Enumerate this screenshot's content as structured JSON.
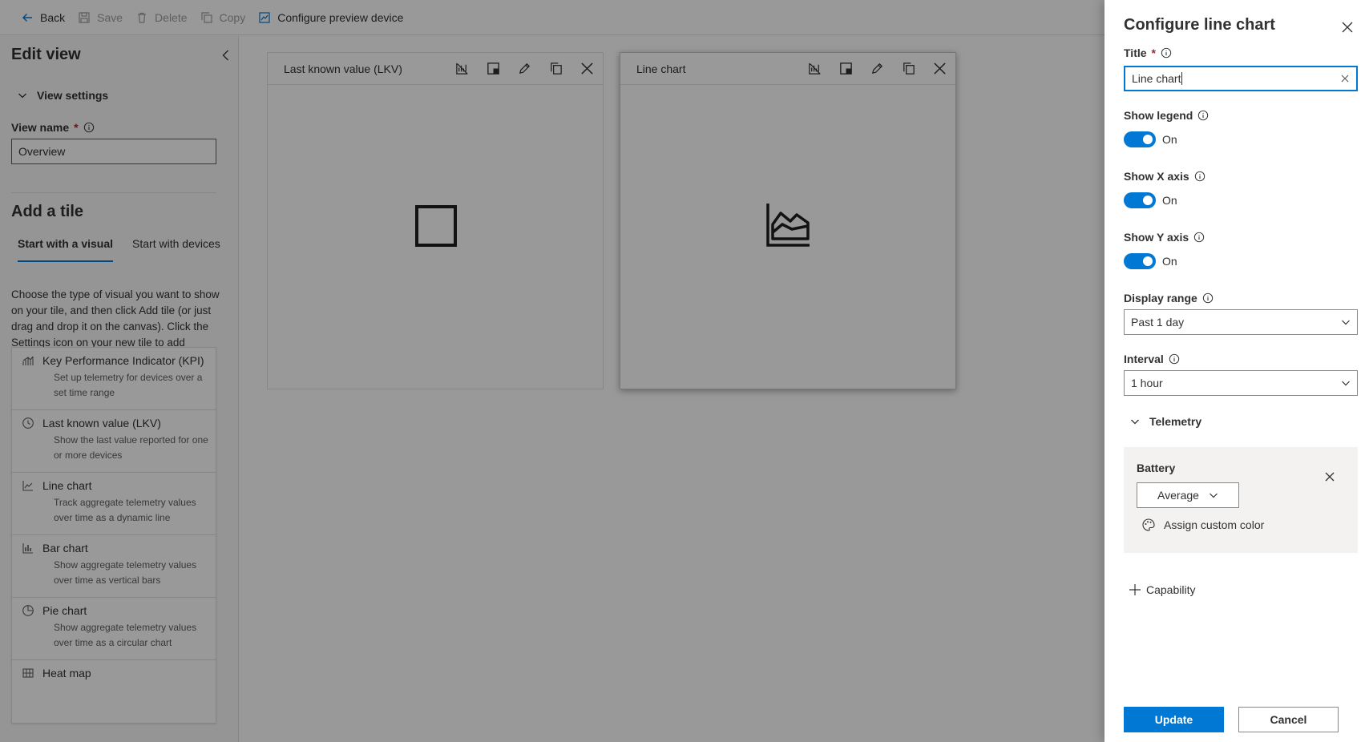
{
  "toolbar": {
    "back_label": "Back",
    "save_label": "Save",
    "delete_label": "Delete",
    "copy_label": "Copy",
    "configure_label": "Configure preview device"
  },
  "left_panel": {
    "title": "Edit view",
    "view_settings_label": "View settings",
    "view_name_label": "View name",
    "view_name_required": "*",
    "view_name_value": "Overview",
    "add_tile_title": "Add a tile",
    "tabs": [
      {
        "label": "Start with a visual",
        "active": true
      },
      {
        "label": "Start with devices",
        "active": false
      }
    ],
    "description": "Choose the type of visual you want to show on your tile, and then click Add tile (or just drag and drop it on the canvas). Click the Settings icon on your new tile to add content or device data.",
    "tiles": [
      {
        "icon": "kpi-icon",
        "title": "Key Performance Indicator (KPI)",
        "subtitle": "Set up telemetry for devices over a set time range"
      },
      {
        "icon": "clock-icon",
        "title": "Last known value (LKV)",
        "subtitle": "Show the last value reported for one or more devices"
      },
      {
        "icon": "line-chart-icon",
        "title": "Line chart",
        "subtitle": "Track aggregate telemetry values over time as a dynamic line"
      },
      {
        "icon": "bar-chart-icon",
        "title": "Bar chart",
        "subtitle": "Show aggregate telemetry values over time as vertical bars"
      },
      {
        "icon": "pie-chart-icon",
        "title": "Pie chart",
        "subtitle": "Show aggregate telemetry values over time as a circular chart"
      },
      {
        "icon": "heat-map-icon",
        "title": "Heat map",
        "subtitle": ""
      }
    ]
  },
  "canvas": {
    "tiles": [
      {
        "title": "Last known value (LKV)",
        "placeholder_icon": "square-icon"
      },
      {
        "title": "Line chart",
        "placeholder_icon": "area-chart-icon"
      }
    ]
  },
  "panel": {
    "title": "Configure line chart",
    "title_label": "Title",
    "title_required": "*",
    "title_value": "Line chart",
    "show_legend_label": "Show legend",
    "show_legend_state": "On",
    "show_x_axis_label": "Show X axis",
    "show_x_axis_state": "On",
    "show_y_axis_label": "Show Y axis",
    "show_y_axis_state": "On",
    "display_range_label": "Display range",
    "display_range_value": "Past 1 day",
    "interval_label": "Interval",
    "interval_value": "1 hour",
    "telemetry_label": "Telemetry",
    "telemetry_item": {
      "name": "Battery",
      "aggregation": "Average",
      "assign_color_label": "Assign custom color"
    },
    "capability_label": "Capability",
    "update_label": "Update",
    "cancel_label": "Cancel"
  },
  "colors": {
    "accent": "#0078d4",
    "required": "#a4262c"
  }
}
